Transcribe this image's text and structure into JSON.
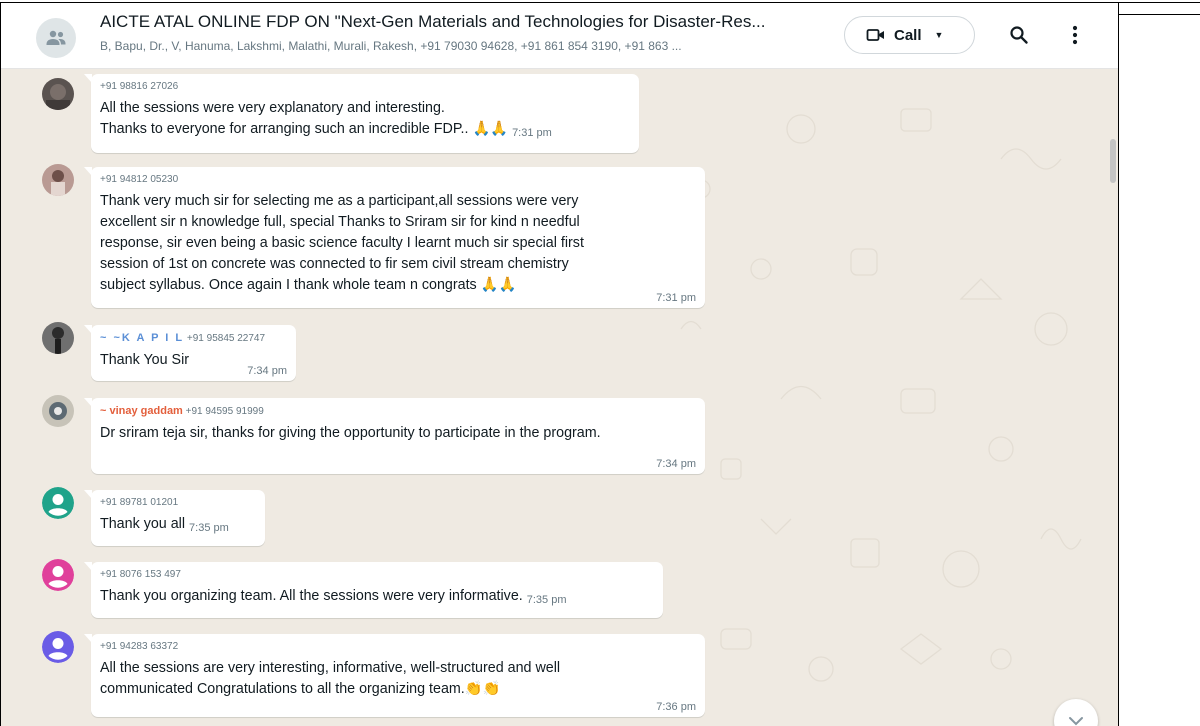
{
  "header": {
    "title": "AICTE ATAL ONLINE FDP ON \"Next-Gen Materials and Technologies for Disaster-Res...",
    "members": "B, Bapu, Dr., V, Hanuma, Lakshmi, Malathi, Murali, Rakesh, +91 79030 94628, +91 861 854 3190, +91 863 ...",
    "call_label": "Call"
  },
  "messages": [
    {
      "sender": "+91 98816 27026",
      "lines": [
        "All the sessions were very explanatory and interesting.",
        "Thanks to everyone for arranging such an incredible FDP.. 🙏🙏"
      ],
      "time": "7:31 pm"
    },
    {
      "sender": "+91 94812 05230",
      "lines": [
        "Thank very much sir for selecting me as a participant,all sessions were very",
        "excellent sir n knowledge full, special Thanks to Sriram sir for kind n needful",
        "response, sir even being a basic science faculty I learnt much sir special first",
        "session of 1st on concrete was connected to fir sem civil stream chemistry",
        "subject syllabus. Once again I thank whole team n congrats 🙏🙏"
      ],
      "time": "7:31 pm"
    },
    {
      "sender_name": "~ ~K A P I L",
      "sender": "+91 95845 22747",
      "lines": [
        "Thank You Sir"
      ],
      "time": "7:34 pm"
    },
    {
      "sender_name": "~ vinay gaddam",
      "sender": "+91 94595 91999",
      "lines": [
        "Dr sriram teja sir, thanks for giving the opportunity to participate in the program."
      ],
      "time": "7:34 pm"
    },
    {
      "sender": "+91 89781 01201",
      "lines": [
        "Thank you all"
      ],
      "time": "7:35 pm"
    },
    {
      "sender": "+91 8076 153 497",
      "lines": [
        "Thank you organizing team. All the sessions were very informative."
      ],
      "time": "7:35 pm"
    },
    {
      "sender": "+91 94283 63372",
      "lines": [
        "All the sessions are very interesting, informative, well-structured and well",
        "communicated Congratulations to all the organizing team.👏👏"
      ],
      "time": "7:36 pm"
    }
  ],
  "colors": {
    "chat_bg": "#efeae2",
    "bubble": "#ffffff",
    "kapil_name": "#5b8fd6",
    "vinay_name": "#e35f3c",
    "avatar_teal": "#1fa38a",
    "avatar_pink": "#e0409b",
    "avatar_purple": "#6a5ce6"
  }
}
